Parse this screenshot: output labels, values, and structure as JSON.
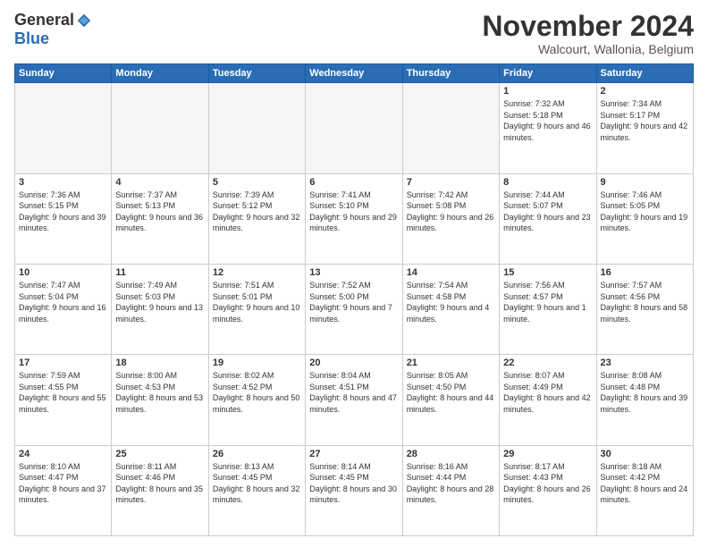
{
  "logo": {
    "general": "General",
    "blue": "Blue"
  },
  "title": "November 2024",
  "subtitle": "Walcourt, Wallonia, Belgium",
  "weekdays": [
    "Sunday",
    "Monday",
    "Tuesday",
    "Wednesday",
    "Thursday",
    "Friday",
    "Saturday"
  ],
  "weeks": [
    [
      {
        "day": "",
        "info": ""
      },
      {
        "day": "",
        "info": ""
      },
      {
        "day": "",
        "info": ""
      },
      {
        "day": "",
        "info": ""
      },
      {
        "day": "",
        "info": ""
      },
      {
        "day": "1",
        "info": "Sunrise: 7:32 AM\nSunset: 5:18 PM\nDaylight: 9 hours and 46 minutes."
      },
      {
        "day": "2",
        "info": "Sunrise: 7:34 AM\nSunset: 5:17 PM\nDaylight: 9 hours and 42 minutes."
      }
    ],
    [
      {
        "day": "3",
        "info": "Sunrise: 7:36 AM\nSunset: 5:15 PM\nDaylight: 9 hours and 39 minutes."
      },
      {
        "day": "4",
        "info": "Sunrise: 7:37 AM\nSunset: 5:13 PM\nDaylight: 9 hours and 36 minutes."
      },
      {
        "day": "5",
        "info": "Sunrise: 7:39 AM\nSunset: 5:12 PM\nDaylight: 9 hours and 32 minutes."
      },
      {
        "day": "6",
        "info": "Sunrise: 7:41 AM\nSunset: 5:10 PM\nDaylight: 9 hours and 29 minutes."
      },
      {
        "day": "7",
        "info": "Sunrise: 7:42 AM\nSunset: 5:08 PM\nDaylight: 9 hours and 26 minutes."
      },
      {
        "day": "8",
        "info": "Sunrise: 7:44 AM\nSunset: 5:07 PM\nDaylight: 9 hours and 23 minutes."
      },
      {
        "day": "9",
        "info": "Sunrise: 7:46 AM\nSunset: 5:05 PM\nDaylight: 9 hours and 19 minutes."
      }
    ],
    [
      {
        "day": "10",
        "info": "Sunrise: 7:47 AM\nSunset: 5:04 PM\nDaylight: 9 hours and 16 minutes."
      },
      {
        "day": "11",
        "info": "Sunrise: 7:49 AM\nSunset: 5:03 PM\nDaylight: 9 hours and 13 minutes."
      },
      {
        "day": "12",
        "info": "Sunrise: 7:51 AM\nSunset: 5:01 PM\nDaylight: 9 hours and 10 minutes."
      },
      {
        "day": "13",
        "info": "Sunrise: 7:52 AM\nSunset: 5:00 PM\nDaylight: 9 hours and 7 minutes."
      },
      {
        "day": "14",
        "info": "Sunrise: 7:54 AM\nSunset: 4:58 PM\nDaylight: 9 hours and 4 minutes."
      },
      {
        "day": "15",
        "info": "Sunrise: 7:56 AM\nSunset: 4:57 PM\nDaylight: 9 hours and 1 minute."
      },
      {
        "day": "16",
        "info": "Sunrise: 7:57 AM\nSunset: 4:56 PM\nDaylight: 8 hours and 58 minutes."
      }
    ],
    [
      {
        "day": "17",
        "info": "Sunrise: 7:59 AM\nSunset: 4:55 PM\nDaylight: 8 hours and 55 minutes."
      },
      {
        "day": "18",
        "info": "Sunrise: 8:00 AM\nSunset: 4:53 PM\nDaylight: 8 hours and 53 minutes."
      },
      {
        "day": "19",
        "info": "Sunrise: 8:02 AM\nSunset: 4:52 PM\nDaylight: 8 hours and 50 minutes."
      },
      {
        "day": "20",
        "info": "Sunrise: 8:04 AM\nSunset: 4:51 PM\nDaylight: 8 hours and 47 minutes."
      },
      {
        "day": "21",
        "info": "Sunrise: 8:05 AM\nSunset: 4:50 PM\nDaylight: 8 hours and 44 minutes."
      },
      {
        "day": "22",
        "info": "Sunrise: 8:07 AM\nSunset: 4:49 PM\nDaylight: 8 hours and 42 minutes."
      },
      {
        "day": "23",
        "info": "Sunrise: 8:08 AM\nSunset: 4:48 PM\nDaylight: 8 hours and 39 minutes."
      }
    ],
    [
      {
        "day": "24",
        "info": "Sunrise: 8:10 AM\nSunset: 4:47 PM\nDaylight: 8 hours and 37 minutes."
      },
      {
        "day": "25",
        "info": "Sunrise: 8:11 AM\nSunset: 4:46 PM\nDaylight: 8 hours and 35 minutes."
      },
      {
        "day": "26",
        "info": "Sunrise: 8:13 AM\nSunset: 4:45 PM\nDaylight: 8 hours and 32 minutes."
      },
      {
        "day": "27",
        "info": "Sunrise: 8:14 AM\nSunset: 4:45 PM\nDaylight: 8 hours and 30 minutes."
      },
      {
        "day": "28",
        "info": "Sunrise: 8:16 AM\nSunset: 4:44 PM\nDaylight: 8 hours and 28 minutes."
      },
      {
        "day": "29",
        "info": "Sunrise: 8:17 AM\nSunset: 4:43 PM\nDaylight: 8 hours and 26 minutes."
      },
      {
        "day": "30",
        "info": "Sunrise: 8:18 AM\nSunset: 4:42 PM\nDaylight: 8 hours and 24 minutes."
      }
    ]
  ]
}
